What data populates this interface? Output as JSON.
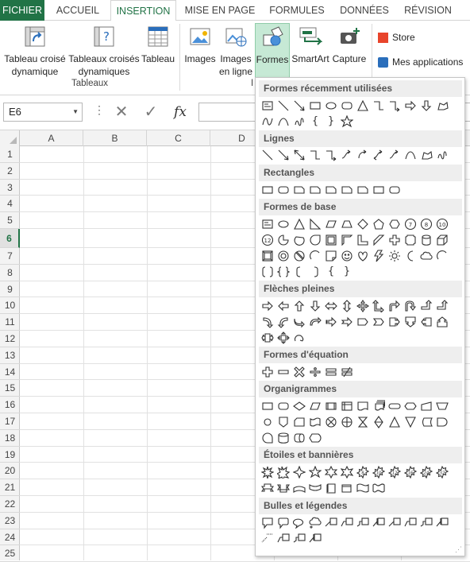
{
  "ribbon_tabs": [
    "FICHIER",
    "ACCUEIL",
    "INSERTION",
    "MISE EN PAGE",
    "FORMULES",
    "DONNÉES",
    "RÉVISION"
  ],
  "ribbon": {
    "tableau_croise": "Tableau croisé\ndynamique",
    "tableaux_croises": "Tableaux croisés\ndynamiques",
    "tableau": "Tableau",
    "group_tableaux": "Tableaux",
    "images": "Images",
    "images_en_ligne": "Images\nen ligne",
    "formes": "Formes",
    "smartart": "SmartArt",
    "capture": "Capture",
    "group_illustrations": "I",
    "store": "Store",
    "mes_applications": "Mes applications"
  },
  "formula_bar": {
    "name_box": "E6",
    "cancel": "✕",
    "enter": "✓",
    "fx": "fx",
    "value": ""
  },
  "grid": {
    "columns": [
      "A",
      "B",
      "C",
      "D"
    ],
    "rows": [
      "1",
      "2",
      "3",
      "4",
      "5",
      "6",
      "7",
      "8",
      "9",
      "10",
      "11",
      "12",
      "13",
      "14",
      "15",
      "16",
      "17",
      "18",
      "19",
      "20",
      "21",
      "22",
      "23",
      "24",
      "25"
    ],
    "active_row": "6"
  },
  "menu": {
    "sections": [
      {
        "title": "Formes récemment utilisées"
      },
      {
        "title": "Lignes"
      },
      {
        "title": "Rectangles"
      },
      {
        "title": "Formes de base"
      },
      {
        "title": "Flèches pleines"
      },
      {
        "title": "Formes d'équation"
      },
      {
        "title": "Organigrammes"
      },
      {
        "title": "Étoiles et bannières"
      },
      {
        "title": "Bulles et légendes"
      }
    ],
    "basic_glyphs": [
      "{",
      "}",
      "{",
      "}"
    ],
    "star_numbers": [
      "8",
      "10",
      "12",
      "16",
      "24",
      "32"
    ],
    "basic_numbers": [
      "7",
      "8",
      "10",
      "12"
    ]
  },
  "colors": {
    "accent": "#217346",
    "selected_button": "#c6e9d5"
  }
}
